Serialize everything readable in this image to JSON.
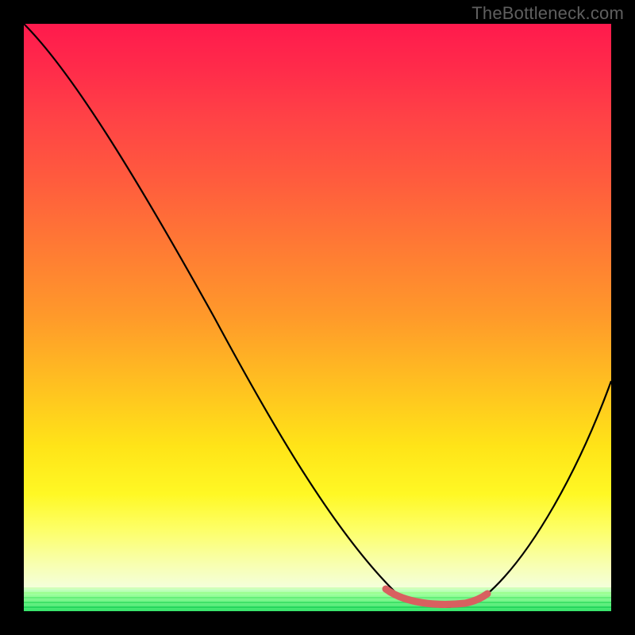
{
  "watermark": "TheBottleneck.com",
  "chart_data": {
    "type": "line",
    "title": "",
    "xlabel": "",
    "ylabel": "",
    "xlim": [
      0,
      100
    ],
    "ylim": [
      0,
      100
    ],
    "series": [
      {
        "name": "curve",
        "x": [
          0,
          5,
          10,
          15,
          20,
          25,
          30,
          35,
          40,
          45,
          50,
          55,
          60,
          65,
          70,
          75,
          80,
          85,
          90,
          95,
          100
        ],
        "values": [
          100,
          94,
          88,
          81,
          74,
          67,
          59,
          51,
          43,
          35,
          27,
          19,
          11,
          4,
          1,
          1,
          3,
          8,
          16,
          27,
          40
        ]
      }
    ],
    "highlight_segment": {
      "name": "bottleneck-zone",
      "x": [
        62,
        65,
        68,
        72,
        75,
        78
      ],
      "values": [
        3,
        1,
        0,
        0,
        1,
        2
      ]
    },
    "background_gradient": {
      "top": "#ff1a4d",
      "mid": "#ffe418",
      "bottom": "#36e36a"
    }
  }
}
